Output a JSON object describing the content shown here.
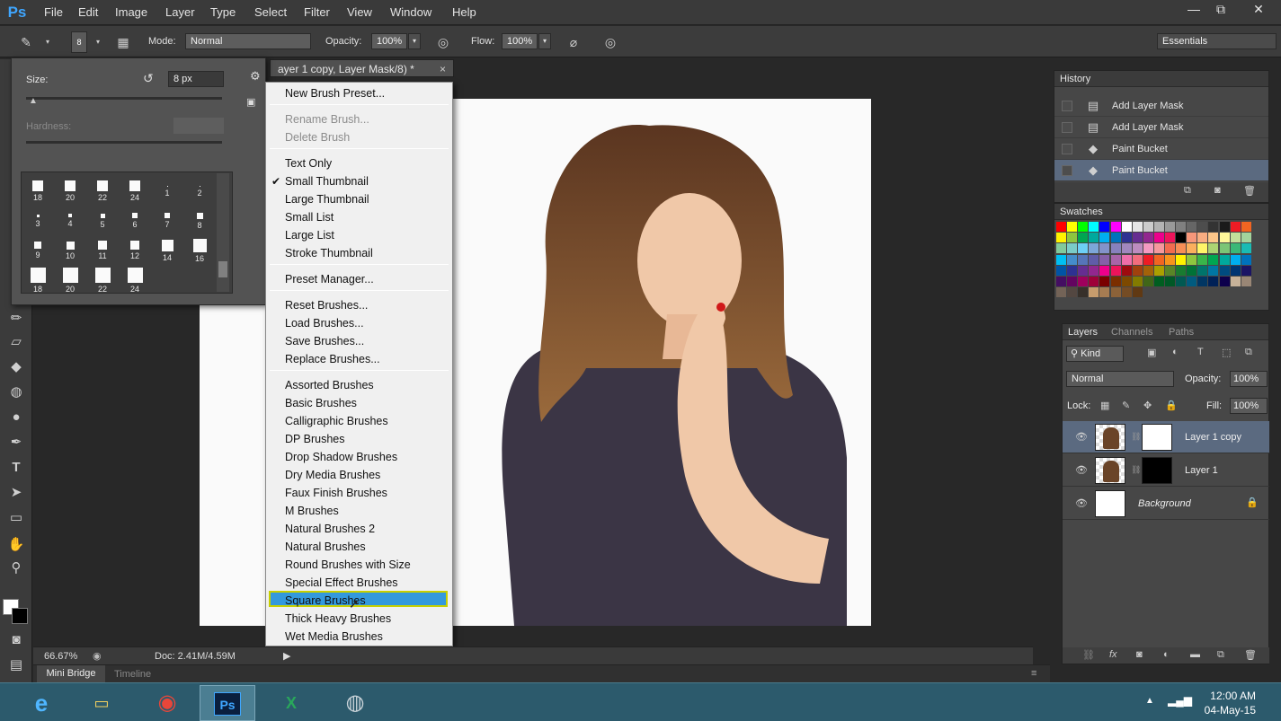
{
  "app": {
    "logo": "Ps",
    "menu": [
      "File",
      "Edit",
      "Image",
      "Layer",
      "Type",
      "Select",
      "Filter",
      "View",
      "Window",
      "Help"
    ],
    "window_buttons": [
      "—",
      "⧉",
      "✕"
    ]
  },
  "options_bar": {
    "brush_size_badge": "8",
    "mode_label": "Mode:",
    "mode_value": "Normal",
    "opacity_label": "Opacity:",
    "opacity_value": "100%",
    "flow_label": "Flow:",
    "flow_value": "100%",
    "workspace": "Essentials"
  },
  "brush_panel": {
    "size_label": "Size:",
    "size_value": "8 px",
    "hardness_label": "Hardness:",
    "brushes": [
      {
        "label": "18",
        "size": 12
      },
      {
        "label": "20",
        "size": 12
      },
      {
        "label": "22",
        "size": 12
      },
      {
        "label": "24",
        "size": 12
      },
      {
        "label": "1",
        "size": 1
      },
      {
        "label": "2",
        "size": 1
      },
      {
        "label": "3",
        "size": 3
      },
      {
        "label": "4",
        "size": 4
      },
      {
        "label": "5",
        "size": 5
      },
      {
        "label": "6",
        "size": 6
      },
      {
        "label": "7",
        "size": 6
      },
      {
        "label": "8",
        "size": 7
      },
      {
        "label": "9",
        "size": 8
      },
      {
        "label": "10",
        "size": 9
      },
      {
        "label": "11",
        "size": 10
      },
      {
        "label": "12",
        "size": 10
      },
      {
        "label": "14",
        "size": 13
      },
      {
        "label": "16",
        "size": 15
      },
      {
        "label": "18",
        "size": 17
      },
      {
        "label": "20",
        "size": 17
      },
      {
        "label": "22",
        "size": 17
      },
      {
        "label": "24",
        "size": 17
      }
    ]
  },
  "document": {
    "tab_title": "ayer 1 copy, Layer Mask/8) *",
    "zoom": "66.67%",
    "doc_size": "Doc: 2.41M/4.59M"
  },
  "context_menu": {
    "groups": [
      [
        {
          "label": "New Brush Preset...",
          "disabled": false
        }
      ],
      [
        {
          "label": "Rename Brush...",
          "disabled": true
        },
        {
          "label": "Delete Brush",
          "disabled": true
        }
      ],
      [
        {
          "label": "Text Only",
          "disabled": false
        },
        {
          "label": "Small Thumbnail",
          "disabled": false,
          "checked": true
        },
        {
          "label": "Large Thumbnail",
          "disabled": false
        },
        {
          "label": "Small List",
          "disabled": false
        },
        {
          "label": "Large List",
          "disabled": false
        },
        {
          "label": "Stroke Thumbnail",
          "disabled": false
        }
      ],
      [
        {
          "label": "Preset Manager...",
          "disabled": false
        }
      ],
      [
        {
          "label": "Reset Brushes...",
          "disabled": false
        },
        {
          "label": "Load Brushes...",
          "disabled": false
        },
        {
          "label": "Save Brushes...",
          "disabled": false
        },
        {
          "label": "Replace Brushes...",
          "disabled": false
        }
      ],
      [
        {
          "label": "Assorted Brushes"
        },
        {
          "label": "Basic Brushes"
        },
        {
          "label": "Calligraphic Brushes"
        },
        {
          "label": "DP Brushes"
        },
        {
          "label": "Drop Shadow Brushes"
        },
        {
          "label": "Dry Media Brushes"
        },
        {
          "label": "Faux Finish Brushes"
        },
        {
          "label": "M Brushes"
        },
        {
          "label": "Natural Brushes 2"
        },
        {
          "label": "Natural Brushes"
        },
        {
          "label": "Round Brushes with Size"
        },
        {
          "label": "Special Effect Brushes"
        },
        {
          "label": "Square Brushes",
          "highlighted": true
        },
        {
          "label": "Thick Heavy Brushes"
        },
        {
          "label": "Wet Media Brushes"
        }
      ]
    ]
  },
  "bottom_tabs": [
    "Mini Bridge",
    "Timeline"
  ],
  "history": {
    "title": "History",
    "items": [
      {
        "icon": "document-icon",
        "label": "Add Layer Mask"
      },
      {
        "icon": "document-icon",
        "label": "Add Layer Mask"
      },
      {
        "icon": "paint-bucket-icon",
        "label": "Paint Bucket"
      },
      {
        "icon": "paint-bucket-icon",
        "label": "Paint Bucket",
        "selected": true
      }
    ]
  },
  "swatches": {
    "title": "Swatches",
    "rows": [
      [
        "#ff0000",
        "#ffff00",
        "#00ff00",
        "#00ffff",
        "#0000ff",
        "#ff00ff",
        "#ffffff",
        "#e6e6e6",
        "#cccccc",
        "#b3b3b3",
        "#999999",
        "#808080",
        "#666666",
        "#4d4d4d",
        "#333333",
        "#1a1a1a",
        "#ed1c24",
        "#f26522"
      ],
      [
        "#fff200",
        "#8dc63f",
        "#00a651",
        "#00a99d",
        "#00aeef",
        "#0072bc",
        "#2e3192",
        "#662d91",
        "#92278f",
        "#ec008c",
        "#ed145b",
        "#000000",
        "#f7977a",
        "#f9ad81",
        "#fdc689",
        "#fff799",
        "#c4df9b",
        "#a3d39c"
      ],
      [
        "#82ca9c",
        "#7accc8",
        "#6dcff6",
        "#7da7d9",
        "#8393ca",
        "#8781bd",
        "#a187be",
        "#bd8cbf",
        "#f49ac1",
        "#f5989d",
        "#f26c4f",
        "#f68e56",
        "#fbaf5d",
        "#fff568",
        "#acd373",
        "#7cc576",
        "#3bb878",
        "#1abbb4"
      ],
      [
        "#00bff3",
        "#448ccb",
        "#5674b9",
        "#605ca8",
        "#8560a8",
        "#a864a8",
        "#f06eaa",
        "#f26d7d",
        "#ed1c24",
        "#f26522",
        "#f7941d",
        "#fff200",
        "#8dc63f",
        "#39b54a",
        "#00a651",
        "#00a99d",
        "#00aeef",
        "#0072bc"
      ],
      [
        "#0054a6",
        "#2e3192",
        "#662d91",
        "#92278f",
        "#ec008c",
        "#ed145b",
        "#9e0b0f",
        "#a0410d",
        "#a36209",
        "#aba000",
        "#598527",
        "#197b30",
        "#007236",
        "#00746b",
        "#0076a3",
        "#004b80",
        "#003471",
        "#1b1464"
      ],
      [
        "#440e62",
        "#630460",
        "#9e005d",
        "#9e0039",
        "#790000",
        "#7b2e00",
        "#7d4900",
        "#827b00",
        "#406618",
        "#005e20",
        "#005826",
        "#005952",
        "#005b7f",
        "#003663",
        "#002157",
        "#0d004c",
        "#c7b299",
        "#998675"
      ],
      [
        "#736357",
        "#534741",
        "#37302a",
        "#c69c6d",
        "#a67c52",
        "#8c6239",
        "#754c24",
        "#603913"
      ]
    ]
  },
  "layers": {
    "tabs": [
      "Layers",
      "Channels",
      "Paths"
    ],
    "kind_label": "Kind",
    "blend_mode": "Normal",
    "opacity_label": "Opacity:",
    "opacity_value": "100%",
    "lock_label": "Lock:",
    "fill_label": "Fill:",
    "fill_value": "100%",
    "items": [
      {
        "name": "Layer 1 copy",
        "selected": true,
        "mask": "white"
      },
      {
        "name": "Layer 1",
        "selected": false,
        "mask": "black"
      },
      {
        "name": "Background",
        "selected": false,
        "locked": true
      }
    ]
  },
  "taskbar": {
    "time": "12:00 AM",
    "date": "04-May-15",
    "apps": [
      "ie-icon",
      "file-explorer-icon",
      "chrome-icon",
      "photoshop-icon",
      "excel-icon",
      "app-icon"
    ]
  }
}
